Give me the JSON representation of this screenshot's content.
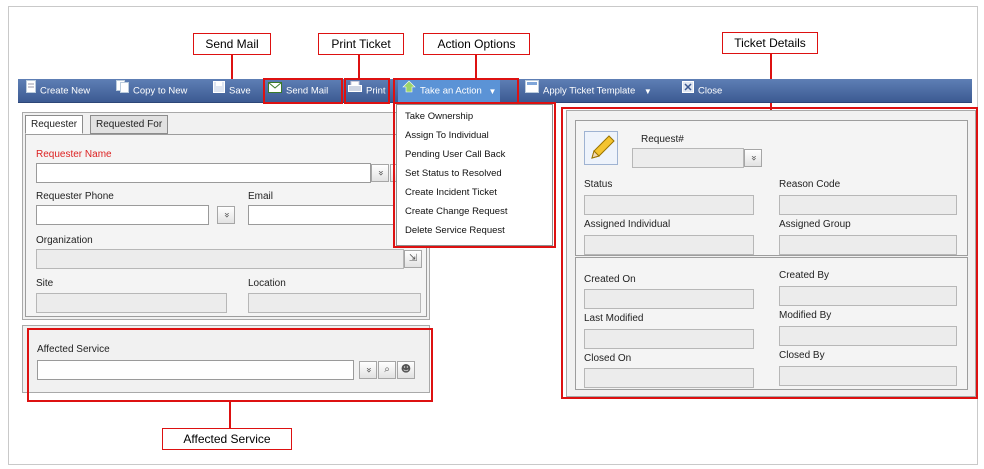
{
  "callouts": {
    "send_mail": "Send Mail",
    "print_ticket": "Print Ticket",
    "action_options": "Action Options",
    "ticket_details": "Ticket Details",
    "affected_service": "Affected Service"
  },
  "toolbar": {
    "create_new": "Create New",
    "copy_to_new": "Copy to New",
    "save": "Save",
    "send_mail": "Send Mail",
    "print": "Print",
    "take_action": "Take an Action",
    "apply_template": "Apply Ticket Template",
    "close": "Close"
  },
  "action_menu": {
    "items": [
      "Take Ownership",
      "Assign To Individual",
      "Pending User Call Back",
      "Set Status to Resolved",
      "Create Incident Ticket",
      "Create Change Request",
      "Delete Service Request"
    ]
  },
  "requester_panel": {
    "tabs": [
      "Requester",
      "Requested For"
    ],
    "requester_name_label": "Requester Name",
    "requester_phone_label": "Requester Phone",
    "email_label": "Email",
    "organization_label": "Organization",
    "site_label": "Site",
    "location_label": "Location"
  },
  "affected_service_panel": {
    "label": "Affected Service"
  },
  "ticket_details": {
    "request_number_label": "Request#",
    "status_label": "Status",
    "reason_code_label": "Reason Code",
    "assigned_individual_label": "Assigned Individual",
    "assigned_group_label": "Assigned Group",
    "created_on_label": "Created On",
    "created_by_label": "Created By",
    "last_modified_label": "Last Modified",
    "modified_by_label": "Modified By",
    "closed_on_label": "Closed On",
    "closed_by_label": "Closed By"
  },
  "icons": {
    "dropdown_glyph": "»",
    "accent_red": "#d11111",
    "toolbar_blue": "#4a6aa3"
  }
}
